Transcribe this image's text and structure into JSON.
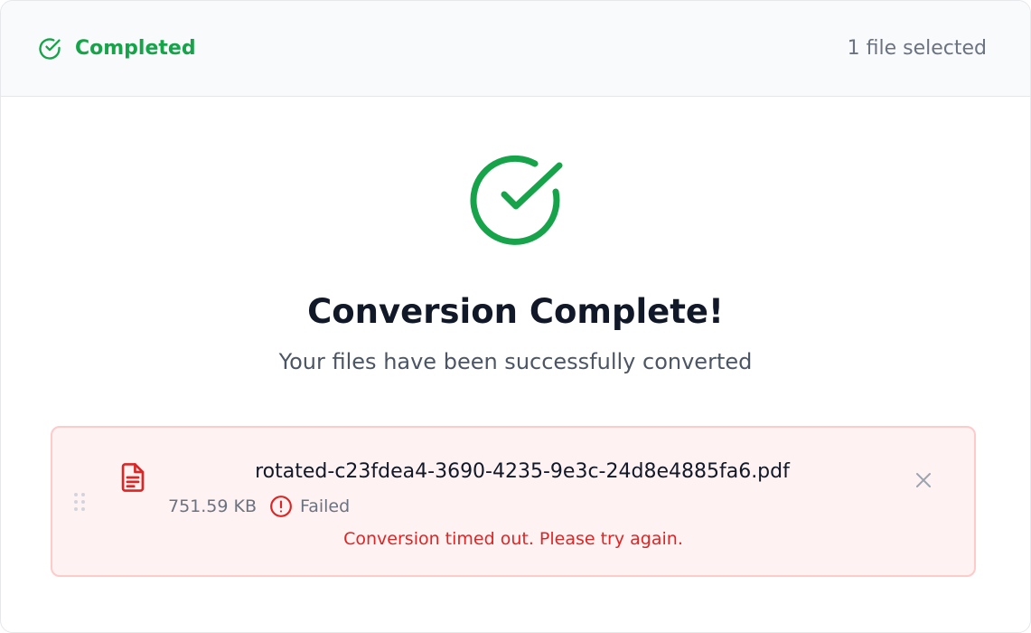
{
  "header": {
    "status_label": "Completed",
    "status_icon": "check-circle-icon",
    "file_count": "1 file selected"
  },
  "result": {
    "title": "Conversion Complete!",
    "subtitle": "Your files have been successfully converted",
    "icon": "check-circle-icon"
  },
  "file": {
    "name": "rotated-c23fdea4-3690-4235-9e3c-24d8e4885fa6.pdf",
    "size": "751.59 KB",
    "status": "Failed",
    "error": "Conversion timed out. Please try again.",
    "icon": "file-document-icon"
  },
  "colors": {
    "success": "#16a34a",
    "danger": "#dc2626",
    "danger_bg": "#fef2f2",
    "danger_border": "#fecaca"
  }
}
